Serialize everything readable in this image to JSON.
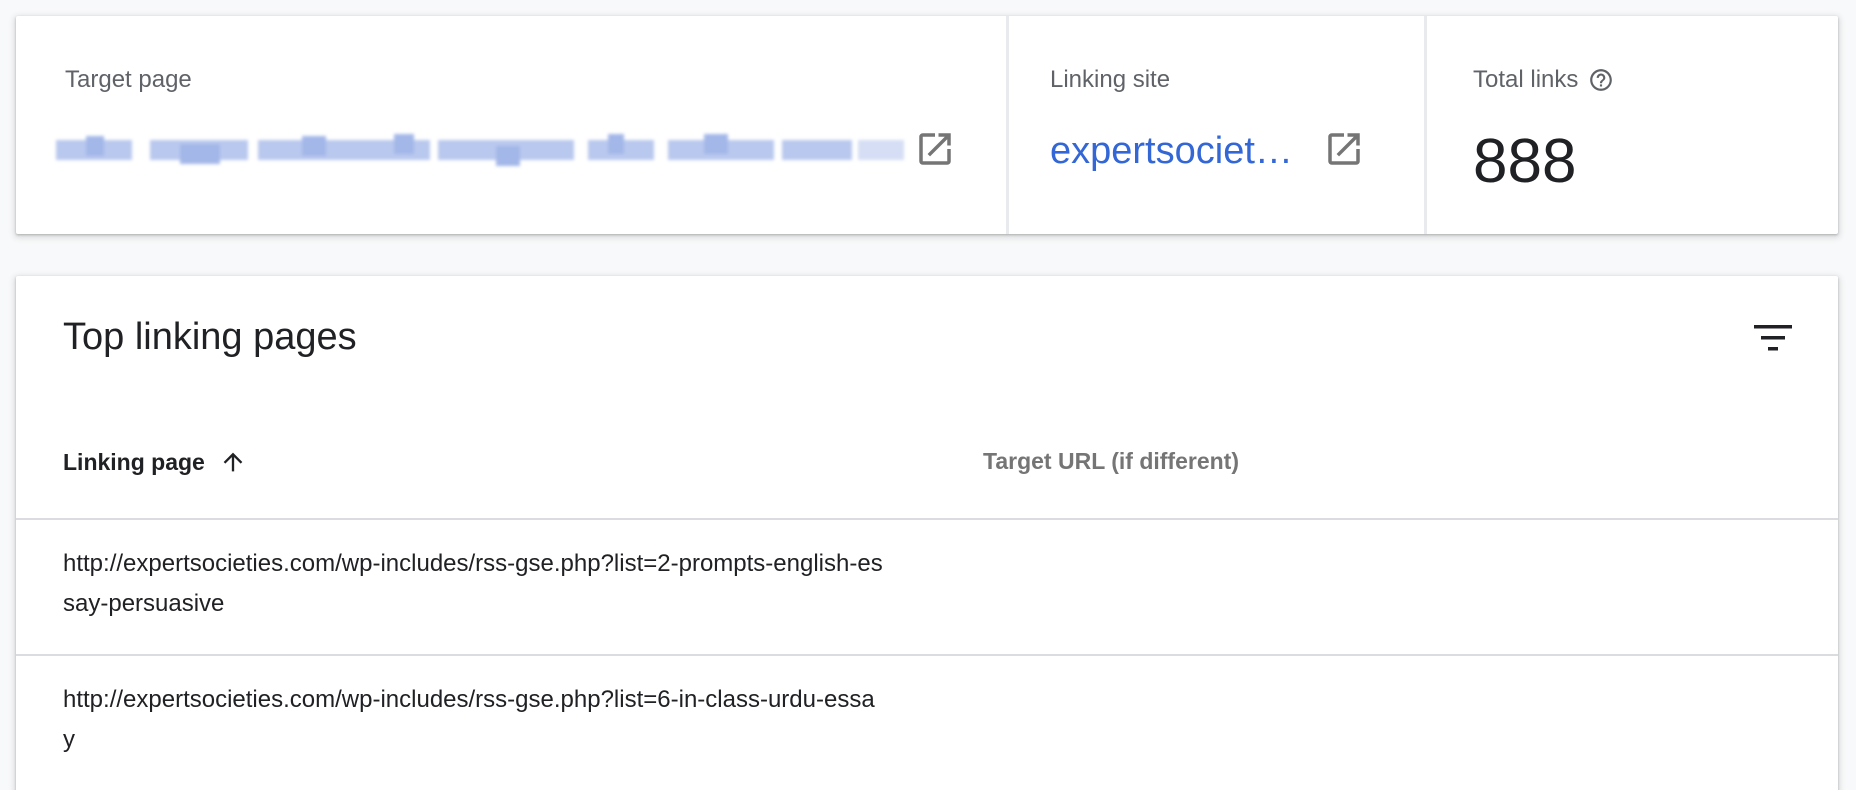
{
  "summary": {
    "target_page": {
      "label": "Target page",
      "value_blurred": true
    },
    "linking_site": {
      "label": "Linking site",
      "value": "expertsocieties.com",
      "link_color": "#3367d6"
    },
    "total_links": {
      "label": "Total links",
      "value": "888"
    },
    "icons": {
      "open": "open-in-new-icon",
      "help": "help-outline-icon"
    }
  },
  "table": {
    "title": "Top linking pages",
    "filter_icon": "filter-list-icon",
    "columns": [
      {
        "label": "Linking page",
        "sort": "ascending",
        "sort_icon": "arrow-upward-icon"
      },
      {
        "label": "Target URL (if different)"
      }
    ],
    "rows": [
      {
        "linking_page": "http://expertsocieties.com/wp-includes/rss-gse.php?list=2-prompts-english-essay-persuasive",
        "target_url": ""
      },
      {
        "linking_page": "http://expertsocieties.com/wp-includes/rss-gse.php?list=6-in-class-urdu-essay",
        "target_url": ""
      }
    ]
  }
}
